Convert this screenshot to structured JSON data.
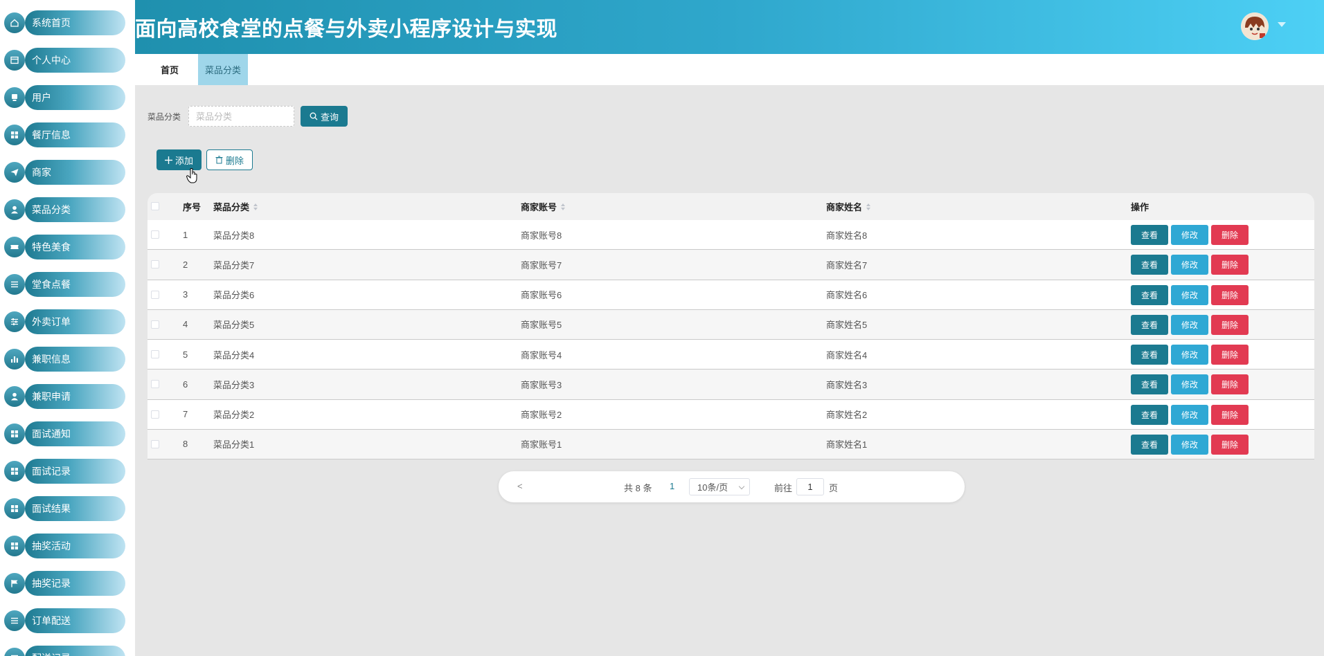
{
  "app": {
    "title": "面向高校食堂的点餐与外卖小程序设计与实现"
  },
  "sidebar": {
    "items": [
      {
        "label": "系统首页",
        "icon": "home-icon"
      },
      {
        "label": "个人中心",
        "icon": "profile-icon"
      },
      {
        "label": "用户",
        "icon": "user-icon"
      },
      {
        "label": "餐厅信息",
        "icon": "grid-icon"
      },
      {
        "label": "商家",
        "icon": "send-icon"
      },
      {
        "label": "菜品分类",
        "icon": "person-icon"
      },
      {
        "label": "特色美食",
        "icon": "ticket-icon"
      },
      {
        "label": "堂食点餐",
        "icon": "list-icon"
      },
      {
        "label": "外卖订单",
        "icon": "sliders-icon"
      },
      {
        "label": "兼职信息",
        "icon": "bar-chart-icon"
      },
      {
        "label": "兼职申请",
        "icon": "person-icon"
      },
      {
        "label": "面试通知",
        "icon": "grid-icon"
      },
      {
        "label": "面试记录",
        "icon": "grid-icon"
      },
      {
        "label": "面试结果",
        "icon": "grid-icon"
      },
      {
        "label": "抽奖活动",
        "icon": "grid-icon"
      },
      {
        "label": "抽奖记录",
        "icon": "flag-icon"
      },
      {
        "label": "订单配送",
        "icon": "list-icon"
      },
      {
        "label": "配送记录",
        "icon": "list-icon"
      }
    ]
  },
  "tabs": {
    "home": "首页",
    "active": "菜品分类"
  },
  "search": {
    "label": "菜品分类",
    "placeholder": "菜品分类",
    "value": "",
    "button": "查询"
  },
  "toolbar": {
    "add": "添加",
    "delete": "删除"
  },
  "table": {
    "columns": {
      "index": "序号",
      "category": "菜品分类",
      "account": "商家账号",
      "name": "商家姓名",
      "actions": "操作"
    },
    "rows": [
      {
        "index": "1",
        "category": "菜品分类8",
        "account": "商家账号8",
        "name": "商家姓名8"
      },
      {
        "index": "2",
        "category": "菜品分类7",
        "account": "商家账号7",
        "name": "商家姓名7"
      },
      {
        "index": "3",
        "category": "菜品分类6",
        "account": "商家账号6",
        "name": "商家姓名6"
      },
      {
        "index": "4",
        "category": "菜品分类5",
        "account": "商家账号5",
        "name": "商家姓名5"
      },
      {
        "index": "5",
        "category": "菜品分类4",
        "account": "商家账号4",
        "name": "商家姓名4"
      },
      {
        "index": "6",
        "category": "菜品分类3",
        "account": "商家账号3",
        "name": "商家姓名3"
      },
      {
        "index": "7",
        "category": "菜品分类2",
        "account": "商家账号2",
        "name": "商家姓名2"
      },
      {
        "index": "8",
        "category": "菜品分类1",
        "account": "商家账号1",
        "name": "商家姓名1"
      }
    ],
    "actions": {
      "view": "查看",
      "edit": "修改",
      "delete": "删除"
    }
  },
  "pagination": {
    "prev": "<",
    "total": "共 8 条",
    "current": "1",
    "page_size": "10条/页",
    "goto_label": "前往",
    "goto_value": "1",
    "page_unit": "页"
  },
  "colors": {
    "primary": "#1b7a90",
    "edit": "#2fa8d4",
    "danger": "#e23a52",
    "header_start": "#1f90ae",
    "header_end": "#4dd0f5"
  }
}
